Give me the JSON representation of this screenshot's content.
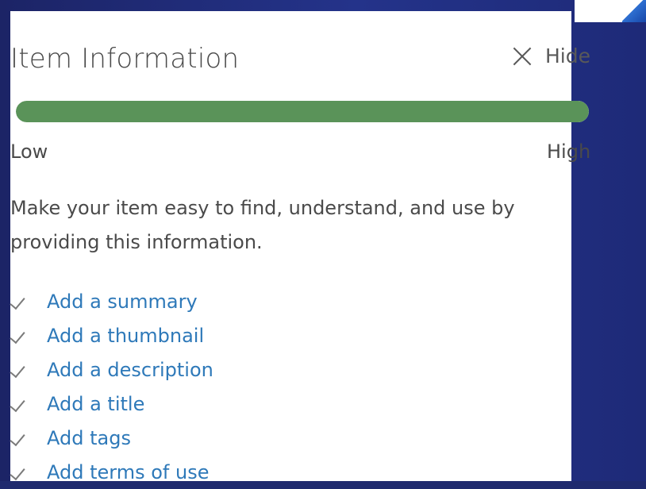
{
  "panel": {
    "title": "Item Information",
    "hide_label": "Hide",
    "meter": {
      "level": 1.0,
      "low_label": "Low",
      "high_label": "High",
      "fill_color": "#5a9359"
    },
    "description": "Make your item easy to find, understand, and use by providing this information.",
    "checklist": [
      {
        "label": "Add a summary",
        "icon": "checkmark-icon"
      },
      {
        "label": "Add a thumbnail",
        "icon": "checkmark-icon"
      },
      {
        "label": "Add a description",
        "icon": "checkmark-icon"
      },
      {
        "label": "Add a title",
        "icon": "checkmark-icon"
      },
      {
        "label": "Add tags",
        "icon": "checkmark-icon"
      },
      {
        "label": "Add terms of use",
        "icon": "checkmark-icon"
      }
    ]
  },
  "colors": {
    "link": "#2e79b9",
    "text": "#4a4a4a",
    "backdrop": "#1f2a6e"
  }
}
